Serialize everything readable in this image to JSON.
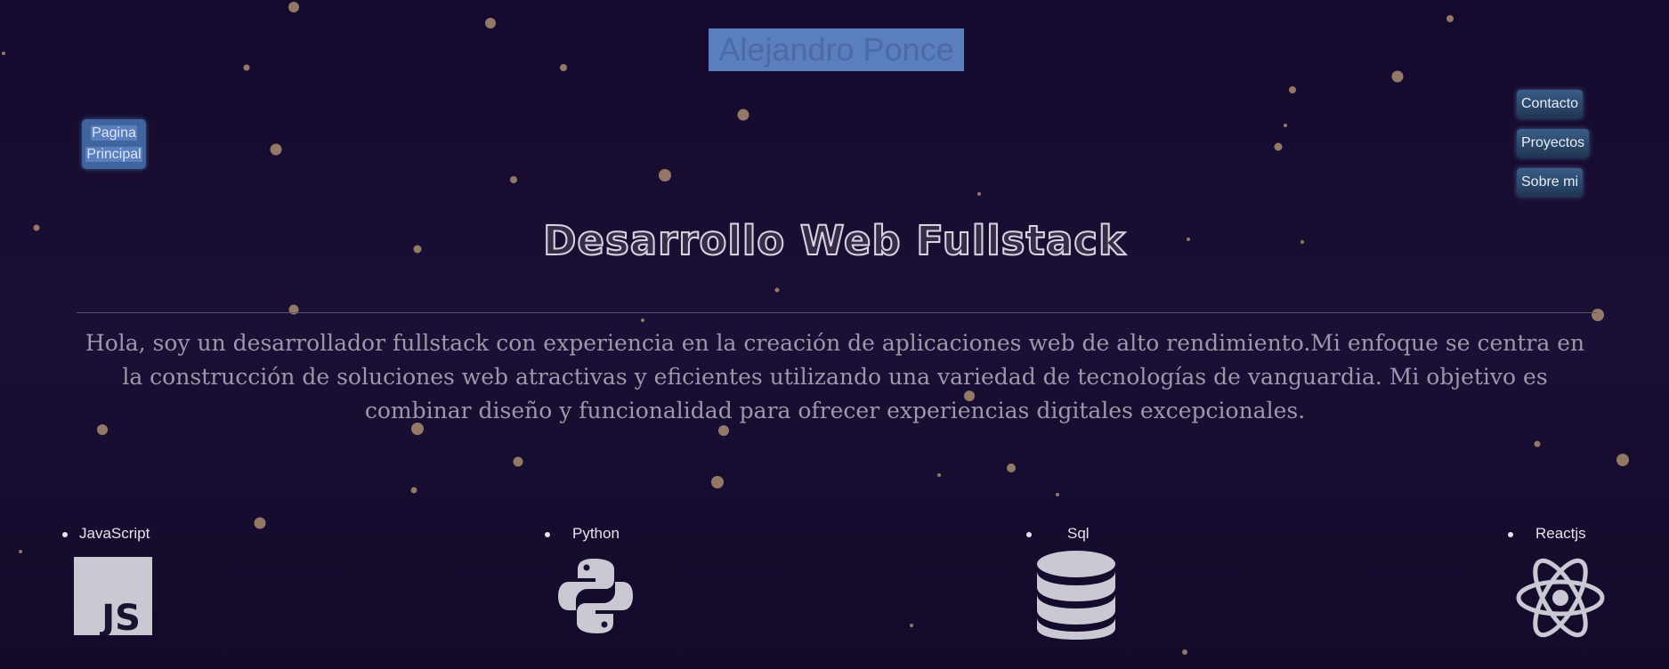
{
  "header": {
    "title": "Alejandro Ponce",
    "home_label_line1": "Pagina",
    "home_label_line2": "Principal"
  },
  "nav": {
    "items": [
      {
        "label": "Contacto"
      },
      {
        "label": "Proyectos"
      },
      {
        "label": "Sobre mi"
      }
    ]
  },
  "hero": {
    "headline": "Desarrollo Web Fullstack",
    "intro_line1": "Hola, soy un desarrollador fullstack con experiencia en la creación de aplicaciones web de alto rendimiento.Mi enfoque se centra en",
    "intro_line2": "la construcción de soluciones web atractivas y eficientes utilizando una variedad de tecnologías de vanguardia. Mi objetivo es",
    "intro_line3": "combinar diseño y funcionalidad para ofrecer experiencias digitales excepcionales."
  },
  "skills": [
    {
      "label": "JavaScript",
      "icon": "javascript-icon"
    },
    {
      "label": "Python",
      "icon": "python-icon"
    },
    {
      "label": "Sql",
      "icon": "database-icon"
    },
    {
      "label": "Reactjs",
      "icon": "react-icon"
    }
  ],
  "colors": {
    "background": "#150a2e",
    "particle": "#b8926a",
    "title_highlight": "#5b7fbd",
    "nav_button": "#2b4a70"
  }
}
